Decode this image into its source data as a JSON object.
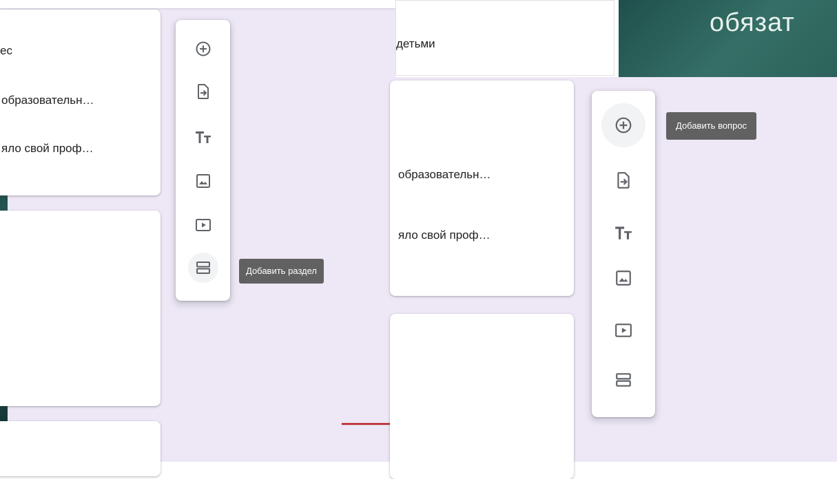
{
  "top_strip": {
    "text": ""
  },
  "corner": {
    "word": "обязат"
  },
  "left_panel": {
    "card1_lines": [
      "ес",
      "образовательн…",
      "яло свой проф…"
    ],
    "toolbar_tooltip": "Добавить раздел"
  },
  "right_panel": {
    "top_card_line": "детьми",
    "card1_lines": [
      "образовательн…",
      "яло свой проф…"
    ],
    "toolbar_tooltip": "Добавить вопрос"
  },
  "toolbar_icons": [
    "add-question-icon",
    "import-questions-icon",
    "add-title-icon",
    "add-image-icon",
    "add-video-icon",
    "add-section-icon"
  ],
  "colors": {
    "form_background": "#ede7f6",
    "tooltip": "#616161",
    "teal_slide": "#356f66",
    "arrow": "#b71c1c"
  }
}
